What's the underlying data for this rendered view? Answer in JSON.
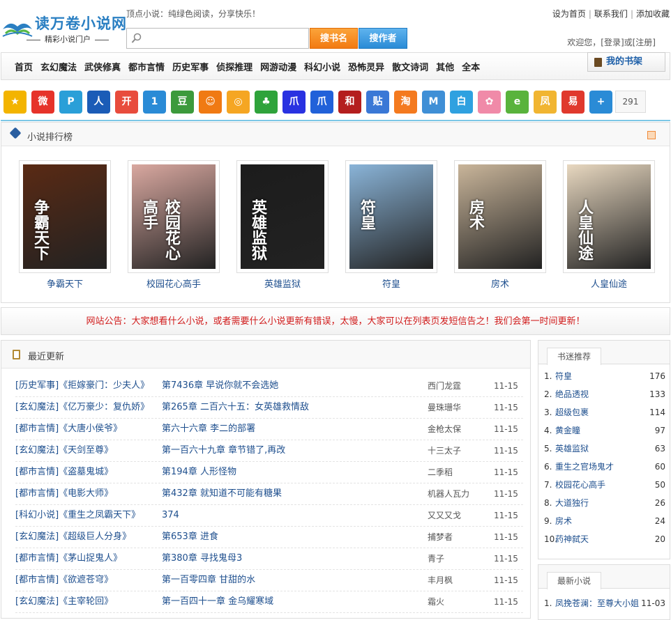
{
  "header": {
    "logo_text": "读万卷小说网",
    "logo_sub": "精彩小说门户",
    "slogan": "顶点小说：纯绿色阅读，分享快乐！",
    "search_placeholder": "",
    "search_book_label": "搜书名",
    "search_author_label": "搜作者",
    "links": [
      "设为首页",
      "联系我们",
      "添加收藏"
    ],
    "welcome": "欢迎您，[登录]或[注册]"
  },
  "nav": {
    "items": [
      "首页",
      "玄幻魔法",
      "武侠修真",
      "都市言情",
      "历史军事",
      "侦探推理",
      "网游动漫",
      "科幻小说",
      "恐怖灵异",
      "散文诗词",
      "其他",
      "全本"
    ],
    "shelf_label": "我的书架"
  },
  "icon_strip": {
    "icons": [
      {
        "name": "favorite-star-icon",
        "color": "#f3b400",
        "glyph": "★"
      },
      {
        "name": "weibo-icon",
        "color": "#e6332a",
        "glyph": "微"
      },
      {
        "name": "pengyou-icon",
        "color": "#2a9fd8",
        "glyph": "P"
      },
      {
        "name": "renren-icon",
        "color": "#1b5cb7",
        "glyph": "人"
      },
      {
        "name": "kaixin-icon",
        "color": "#e84c3d",
        "glyph": "开"
      },
      {
        "name": "yiqi-icon",
        "color": "#2a8bd6",
        "glyph": "1"
      },
      {
        "name": "douban-icon",
        "color": "#3c9a3c",
        "glyph": "豆"
      },
      {
        "name": "smiley-icon",
        "color": "#f07a13",
        "glyph": "☺"
      },
      {
        "name": "qzone-icon",
        "color": "#f5a623",
        "glyph": "◎"
      },
      {
        "name": "clover-icon",
        "color": "#2fa33b",
        "glyph": "♣"
      },
      {
        "name": "baidu-paw-icon",
        "color": "#2932e1",
        "glyph": "爪"
      },
      {
        "name": "baidu-paw-2-icon",
        "color": "#2161d9",
        "glyph": "爪"
      },
      {
        "name": "hexun-icon",
        "color": "#b41e1e",
        "glyph": "和"
      },
      {
        "name": "tieba-icon",
        "color": "#3a78d6",
        "glyph": "贴"
      },
      {
        "name": "taobao-icon",
        "color": "#f47a1f",
        "glyph": "淘"
      },
      {
        "name": "msn-icon",
        "color": "#3f8fd6",
        "glyph": "M"
      },
      {
        "name": "baijia-icon",
        "color": "#2fa1e0",
        "glyph": "白"
      },
      {
        "name": "flower-icon",
        "color": "#f08aa8",
        "glyph": "✿"
      },
      {
        "name": "sohu-icon",
        "color": "#59b33c",
        "glyph": "e"
      },
      {
        "name": "ifeng-icon",
        "color": "#f1b531",
        "glyph": "凤"
      },
      {
        "name": "netease-icon",
        "color": "#e0392d",
        "glyph": "易"
      },
      {
        "name": "more-plus-icon",
        "color": "#2a8bd6",
        "glyph": "+"
      }
    ],
    "count": "291"
  },
  "ranking": {
    "title": "小说排行榜",
    "books": [
      {
        "title": "争霸天下",
        "cover_text": "争霸天下",
        "cover_color": "#5a2a14"
      },
      {
        "title": "校园花心高手",
        "cover_text": "校园花心高手",
        "cover_color": "#d9a8a0"
      },
      {
        "title": "英雄监狱",
        "cover_text": "英雄监狱",
        "cover_color": "#1c1c1c"
      },
      {
        "title": "符皇",
        "cover_text": "符皇",
        "cover_color": "#8ab4d8"
      },
      {
        "title": "房术",
        "cover_text": "房术",
        "cover_color": "#c9b59a"
      },
      {
        "title": "人皇仙途",
        "cover_text": "人皇仙途",
        "cover_color": "#e8d8c0"
      }
    ]
  },
  "notice": "网站公告：大家想看什么小说，或者需要什么小说更新有错误，太慢，大家可以在列表页发短信告之！我们会第一时间更新！",
  "recent": {
    "title": "最近更新",
    "rows": [
      {
        "cat": "[历史军事]《拒嫁豪门：少夫人》",
        "chap": "第7436章 早说你就不会选她",
        "author": "西门龙霆",
        "date": "11-15"
      },
      {
        "cat": "[玄幻魔法]《亿万豪少：复仇娇》",
        "chap": "第265章 二百六十五：女英雄救情敌",
        "author": "曼珠珊华",
        "date": "11-15"
      },
      {
        "cat": "[都市言情]《大唐小侯爷》",
        "chap": "第六十六章 李二的部署",
        "author": "金枪太保",
        "date": "11-15"
      },
      {
        "cat": "[玄幻魔法]《天剑至尊》",
        "chap": "第一百六十九章 章节错了,再改",
        "author": "十三太子",
        "date": "11-15"
      },
      {
        "cat": "[都市言情]《盗墓鬼城》",
        "chap": "第194章 人形怪物",
        "author": "二季稻",
        "date": "11-15"
      },
      {
        "cat": "[都市言情]《电影大师》",
        "chap": "第432章 就知道不可能有糖果",
        "author": "机器人瓦力",
        "date": "11-15"
      },
      {
        "cat": "[科幻小说]《重生之凤霸天下》",
        "chap": "374",
        "author": "又又又戈",
        "date": "11-15"
      },
      {
        "cat": "[玄幻魔法]《超级巨人分身》",
        "chap": "第653章 进食",
        "author": "捕梦者",
        "date": "11-15"
      },
      {
        "cat": "[都市言情]《茅山捉鬼人》",
        "chap": "第380章 寻找鬼母3",
        "author": "青子",
        "date": "11-15"
      },
      {
        "cat": "[都市言情]《欲遮苍穹》",
        "chap": "第一百零四章 甘甜的水",
        "author": "丰月枫",
        "date": "11-15"
      },
      {
        "cat": "[玄幻魔法]《主宰轮回》",
        "chap": "第一百四十一章 金乌耀寒域",
        "author": "霜火",
        "date": "11-15"
      }
    ]
  },
  "sidebar": {
    "recommend_title": "书迷推荐",
    "recommend": [
      {
        "num": "1.",
        "name": "符皇",
        "value": "176"
      },
      {
        "num": "2.",
        "name": "绝品透视",
        "value": "133"
      },
      {
        "num": "3.",
        "name": "超级包裹",
        "value": "114"
      },
      {
        "num": "4.",
        "name": "黄金瞳",
        "value": "97"
      },
      {
        "num": "5.",
        "name": "英雄监狱",
        "value": "63"
      },
      {
        "num": "6.",
        "name": "重生之官场鬼才",
        "value": "60"
      },
      {
        "num": "7.",
        "name": "校园花心高手",
        "value": "50"
      },
      {
        "num": "8.",
        "name": "大道独行",
        "value": "26"
      },
      {
        "num": "9.",
        "name": "房术",
        "value": "24"
      },
      {
        "num": "10.",
        "name": "药神弑天",
        "value": "20"
      }
    ],
    "latest_title": "最新小说",
    "latest": [
      {
        "num": "1.",
        "name": "凤挽苍澜：至尊大小姐",
        "value": "11-03"
      }
    ]
  }
}
